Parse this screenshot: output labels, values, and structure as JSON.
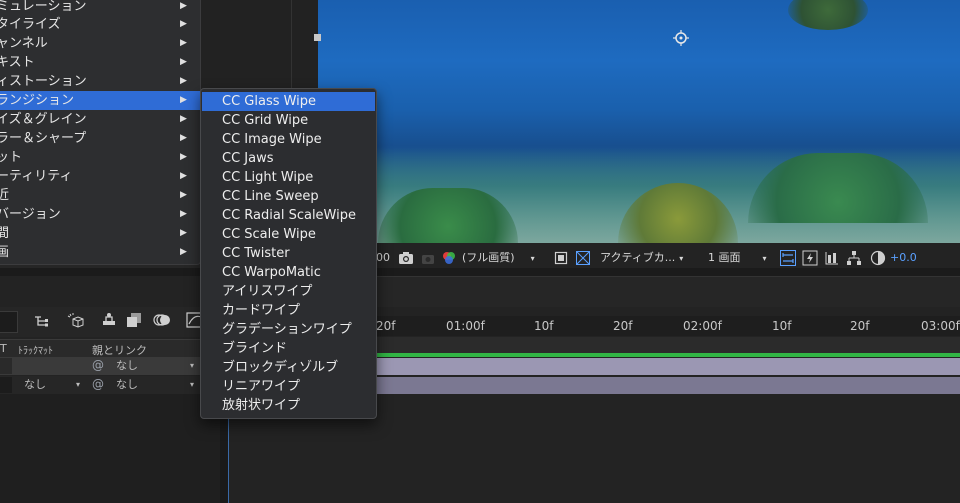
{
  "menu": {
    "items": [
      {
        "label": "ミュレーション",
        "active": false
      },
      {
        "label": "タイライズ",
        "active": false
      },
      {
        "label": "ャンネル",
        "active": false
      },
      {
        "label": "キスト",
        "active": false
      },
      {
        "label": "ィストーション",
        "active": false
      },
      {
        "label": "ランジション",
        "active": true
      },
      {
        "label": "イズ＆グレイン",
        "active": false
      },
      {
        "label": "ラー＆シャープ",
        "active": false
      },
      {
        "label": "ット",
        "active": false
      },
      {
        "label": "ーティリティ",
        "active": false
      },
      {
        "label": "近",
        "active": false
      },
      {
        "label": "バージョン",
        "active": false
      },
      {
        "label": "間",
        "active": false
      },
      {
        "label": "画",
        "active": false
      }
    ],
    "arrow": "▶"
  },
  "submenu": {
    "items": [
      {
        "label": "CC Glass Wipe",
        "active": true
      },
      {
        "label": "CC Grid Wipe",
        "active": false
      },
      {
        "label": "CC Image Wipe",
        "active": false
      },
      {
        "label": "CC Jaws",
        "active": false
      },
      {
        "label": "CC Light Wipe",
        "active": false
      },
      {
        "label": "CC Line Sweep",
        "active": false
      },
      {
        "label": "CC Radial ScaleWipe",
        "active": false
      },
      {
        "label": "CC Scale Wipe",
        "active": false
      },
      {
        "label": "CC Twister",
        "active": false
      },
      {
        "label": "CC WarpoMatic",
        "active": false
      },
      {
        "label": "アイリスワイプ",
        "active": false
      },
      {
        "label": "カードワイプ",
        "active": false
      },
      {
        "label": "グラデーションワイプ",
        "active": false
      },
      {
        "label": "ブラインド",
        "active": false
      },
      {
        "label": "ブロックディゾルブ",
        "active": false
      },
      {
        "label": "リニアワイプ",
        "active": false
      },
      {
        "label": "放射状ワイプ",
        "active": false
      }
    ]
  },
  "viewer_toolbar": {
    "zoom_partial": "00",
    "resolution": "(フル画質)",
    "camera": "アクティブカ...",
    "view": "1 画面",
    "exposure": "+0.0"
  },
  "timeline": {
    "ruler": [
      "20f",
      "01:00f",
      "10f",
      "20f",
      "02:00f",
      "10f",
      "20f",
      "03:00f"
    ],
    "header": {
      "col_t": "T",
      "track_matte": "ﾄﾗｯｸﾏｯﾄ",
      "parent_link": "親とリンク"
    },
    "rows": [
      {
        "track_matte": "",
        "parent": "なし"
      },
      {
        "track_matte": "なし",
        "parent": "なし"
      }
    ]
  },
  "colors": {
    "menu_highlight": "#2f6cd6",
    "accent_blue": "#5aa0ff",
    "work_bar_green": "#31b545",
    "layer_bar": "#9b97b3"
  }
}
